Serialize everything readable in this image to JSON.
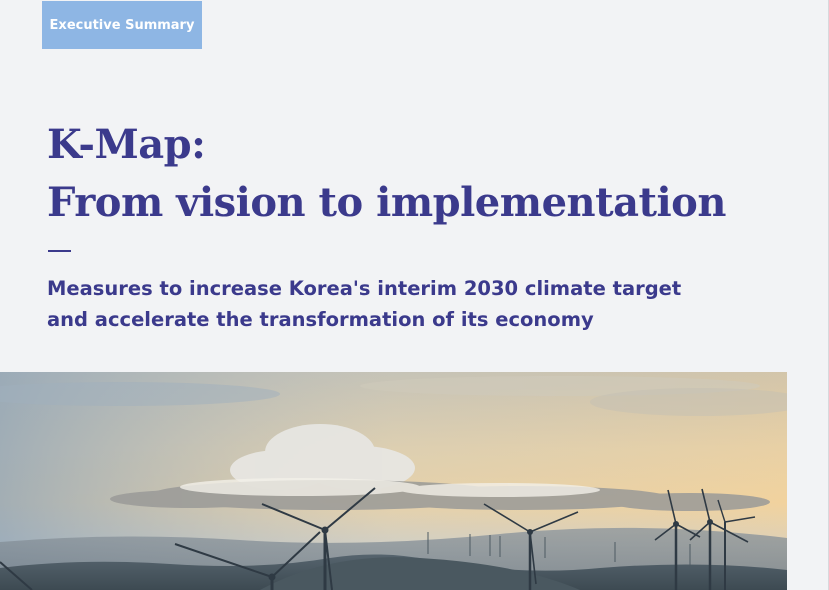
{
  "header": {
    "section_tag": "Executive Summary"
  },
  "hero": {
    "title_line1": "K-Map:",
    "title_line2": "From vision to implementation",
    "subtitle_line1": "Measures to increase Korea's interim 2030 climate target",
    "subtitle_line2": "and accelerate the transformation of its economy"
  },
  "image": {
    "subject": "wind-turbines-at-sunset"
  },
  "colors": {
    "accent": "#3b3a8c",
    "tag_background": "#8eb6e4",
    "page_background": "#f2f3f5"
  }
}
